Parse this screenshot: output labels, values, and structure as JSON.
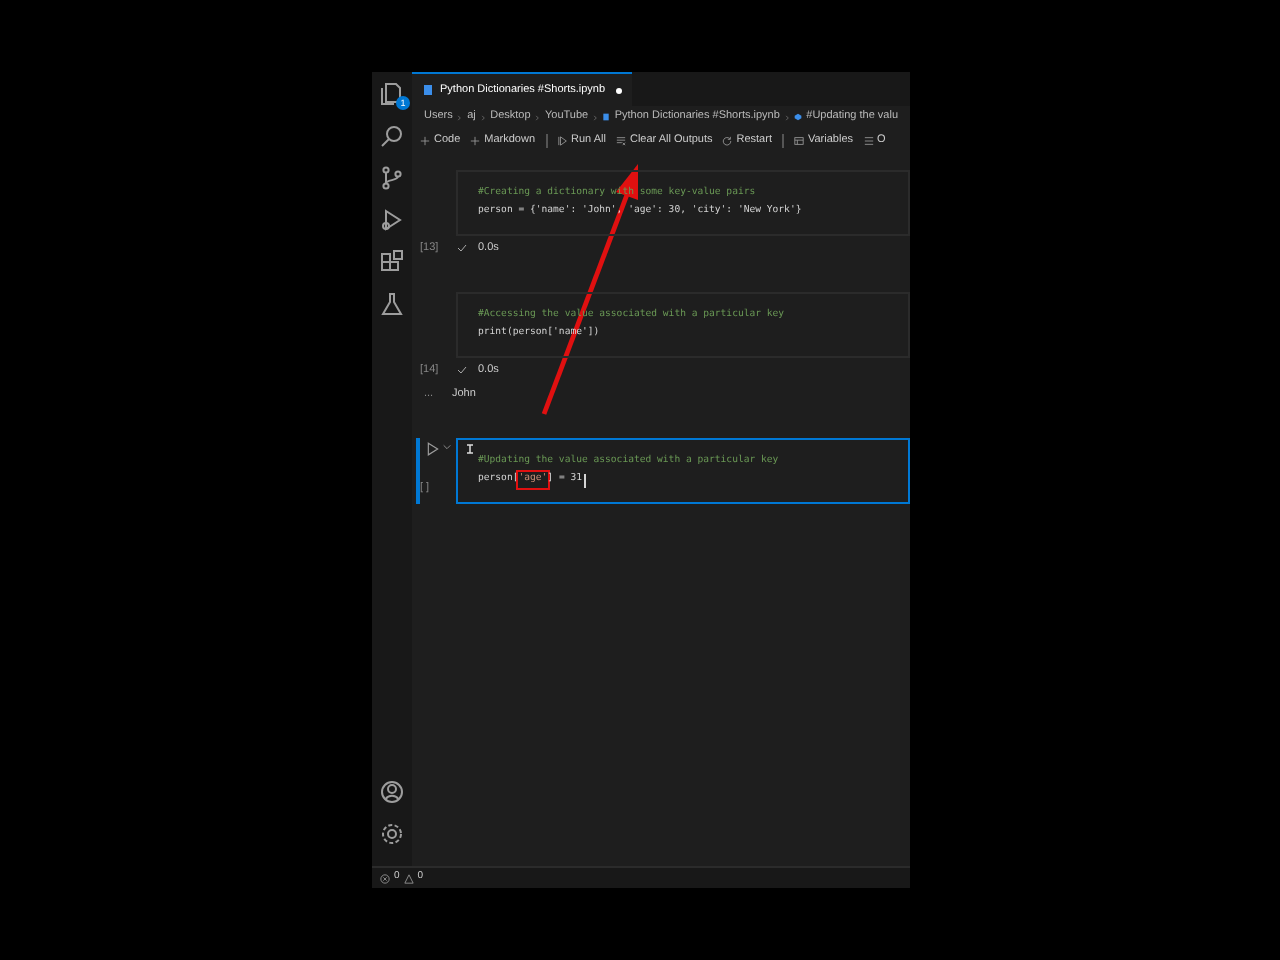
{
  "tab": {
    "title": "Python Dictionaries #Shorts.ipynb",
    "modified": true
  },
  "activity_badge": "1",
  "breadcrumb": [
    {
      "kind": "folder",
      "text": "Users"
    },
    {
      "kind": "folder",
      "text": "aj"
    },
    {
      "kind": "folder",
      "text": "Desktop"
    },
    {
      "kind": "folder",
      "text": "YouTube"
    },
    {
      "kind": "notebook",
      "text": "Python Dictionaries #Shorts.ipynb"
    },
    {
      "kind": "cell",
      "text": "#Updating the valu"
    }
  ],
  "toolbar": [
    {
      "kind": "plus",
      "label": "Code"
    },
    {
      "kind": "plus",
      "label": "Markdown"
    },
    {
      "kind": "run",
      "label": "Run All"
    },
    {
      "kind": "clear",
      "label": "Clear All Outputs"
    },
    {
      "kind": "restart",
      "label": "Restart"
    },
    {
      "kind": "variables",
      "label": "Variables"
    },
    {
      "kind": "outline",
      "label": "O"
    }
  ],
  "cells": [
    {
      "selected": false,
      "execution_count": "[13]",
      "executed": true,
      "duration": "0.0s",
      "lines": [
        {
          "kind": "comment",
          "segments": [
            {
              "text": "#Creating a dictionary with some key-value pairs",
              "boxed": false
            }
          ]
        },
        {
          "kind": "code",
          "segments": [
            {
              "text": "person = {'name': 'John', 'age': 30, 'city': 'New York'}",
              "boxed": false
            }
          ]
        }
      ]
    },
    {
      "selected": false,
      "execution_count": "[14]",
      "executed": true,
      "duration": "0.0s",
      "output_marker": "...",
      "output": "John",
      "lines": [
        {
          "kind": "comment",
          "segments": [
            {
              "text": "#Accessing the value associated with a particular key",
              "boxed": false
            }
          ]
        },
        {
          "kind": "code",
          "segments": [
            {
              "text": "print(person['name'])",
              "boxed": false
            }
          ]
        }
      ]
    },
    {
      "selected": true,
      "execution_count": "[ ]",
      "executed": false,
      "lines": [
        {
          "kind": "comment",
          "segments": [
            {
              "text": "#Updating the value associated with a particular key",
              "boxed": false
            }
          ]
        },
        {
          "kind": "code",
          "segments": [
            {
              "text": "person[",
              "boxed": false
            },
            {
              "text": "'age'",
              "boxed": true
            },
            {
              "text": "] = 31",
              "boxed": false
            }
          ]
        }
      ]
    }
  ],
  "status_bar": {
    "errors": "0",
    "warnings": "0"
  }
}
